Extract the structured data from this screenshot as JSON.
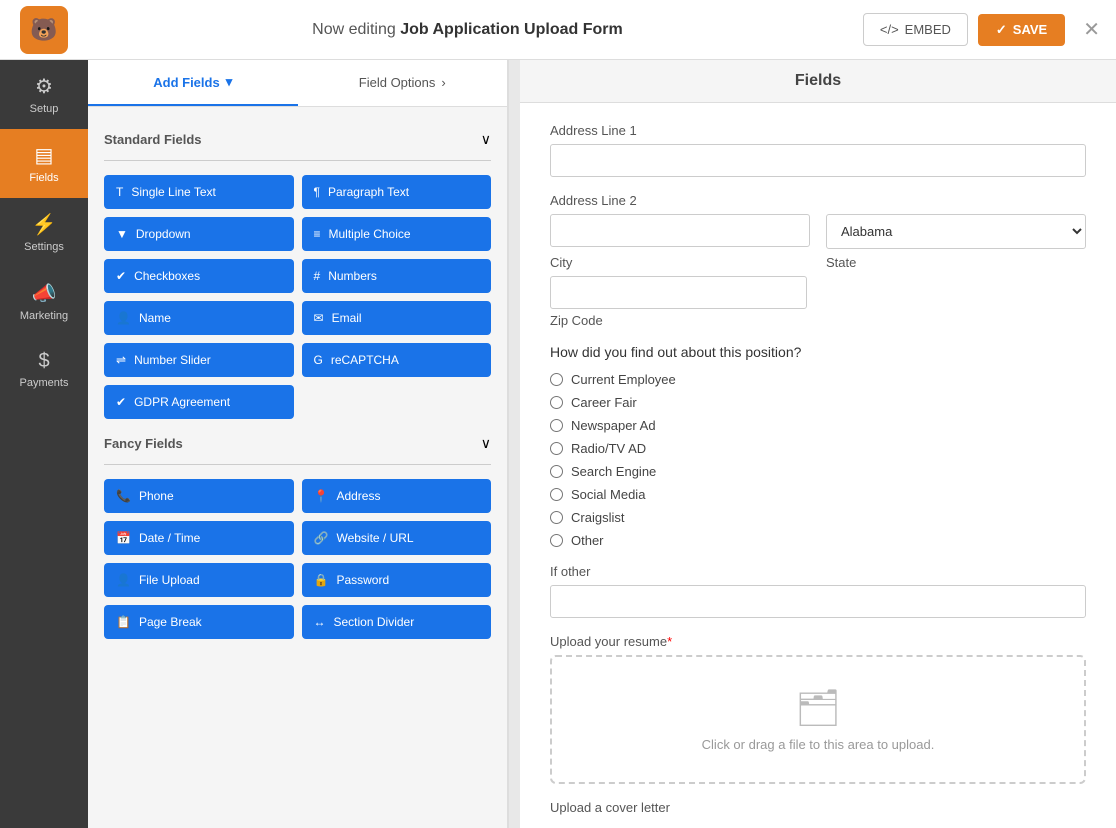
{
  "topbar": {
    "logo_char": "🐻",
    "editing_prefix": "Now editing",
    "form_name": "Job Application Upload Form",
    "embed_label": "EMBED",
    "save_label": "SAVE",
    "embed_icon": "</>",
    "save_icon": "✓",
    "close_icon": "✕"
  },
  "sidebar": {
    "items": [
      {
        "id": "setup",
        "label": "Setup",
        "icon": "⚙"
      },
      {
        "id": "fields",
        "label": "Fields",
        "icon": "▤",
        "active": true
      },
      {
        "id": "settings",
        "label": "Settings",
        "icon": "⚡"
      },
      {
        "id": "marketing",
        "label": "Marketing",
        "icon": "📣"
      },
      {
        "id": "payments",
        "label": "Payments",
        "icon": "$"
      }
    ]
  },
  "panel": {
    "fields_header": "Fields",
    "add_fields_tab": "Add Fields",
    "field_options_tab": "Field Options",
    "standard_fields_section": "Standard Fields",
    "fancy_fields_section": "Fancy Fields",
    "standard_fields": [
      {
        "id": "single-line-text",
        "label": "Single Line Text",
        "icon": "T"
      },
      {
        "id": "paragraph-text",
        "label": "Paragraph Text",
        "icon": "¶"
      },
      {
        "id": "dropdown",
        "label": "Dropdown",
        "icon": "▼"
      },
      {
        "id": "multiple-choice",
        "label": "Multiple Choice",
        "icon": "≡"
      },
      {
        "id": "checkboxes",
        "label": "Checkboxes",
        "icon": "✔"
      },
      {
        "id": "numbers",
        "label": "Numbers",
        "icon": "#"
      },
      {
        "id": "name",
        "label": "Name",
        "icon": "👤"
      },
      {
        "id": "email",
        "label": "Email",
        "icon": "✉"
      },
      {
        "id": "number-slider",
        "label": "Number Slider",
        "icon": "⇌"
      },
      {
        "id": "recaptcha",
        "label": "reCAPTCHA",
        "icon": "G"
      },
      {
        "id": "gdpr-agreement",
        "label": "GDPR Agreement",
        "icon": "✔"
      }
    ],
    "fancy_fields": [
      {
        "id": "phone",
        "label": "Phone",
        "icon": "📞"
      },
      {
        "id": "address",
        "label": "Address",
        "icon": "📍"
      },
      {
        "id": "date-time",
        "label": "Date / Time",
        "icon": "📅"
      },
      {
        "id": "website-url",
        "label": "Website / URL",
        "icon": "🔗"
      },
      {
        "id": "file-upload",
        "label": "File Upload",
        "icon": "👤"
      },
      {
        "id": "password",
        "label": "Password",
        "icon": "🔒"
      },
      {
        "id": "page-break",
        "label": "Page Break",
        "icon": "📋"
      },
      {
        "id": "section-divider",
        "label": "Section Divider",
        "icon": "↔"
      }
    ]
  },
  "form": {
    "title": "Fields",
    "address_line1_label": "Address Line 1",
    "address_line2_label": "Address Line 2",
    "state_default": "Alabama",
    "city_label": "City",
    "state_label": "State",
    "zip_code_label": "Zip Code",
    "position_question": "How did you find out about this position?",
    "position_options": [
      "Current Employee",
      "Career Fair",
      "Newspaper Ad",
      "Radio/TV AD",
      "Search Engine",
      "Social Media",
      "Craigslist",
      "Other"
    ],
    "if_other_label": "If other",
    "upload_resume_label": "Upload your resume",
    "upload_resume_required": true,
    "upload_text": "Click or drag a file to this area to upload.",
    "upload_cover_label": "Upload a cover letter"
  }
}
